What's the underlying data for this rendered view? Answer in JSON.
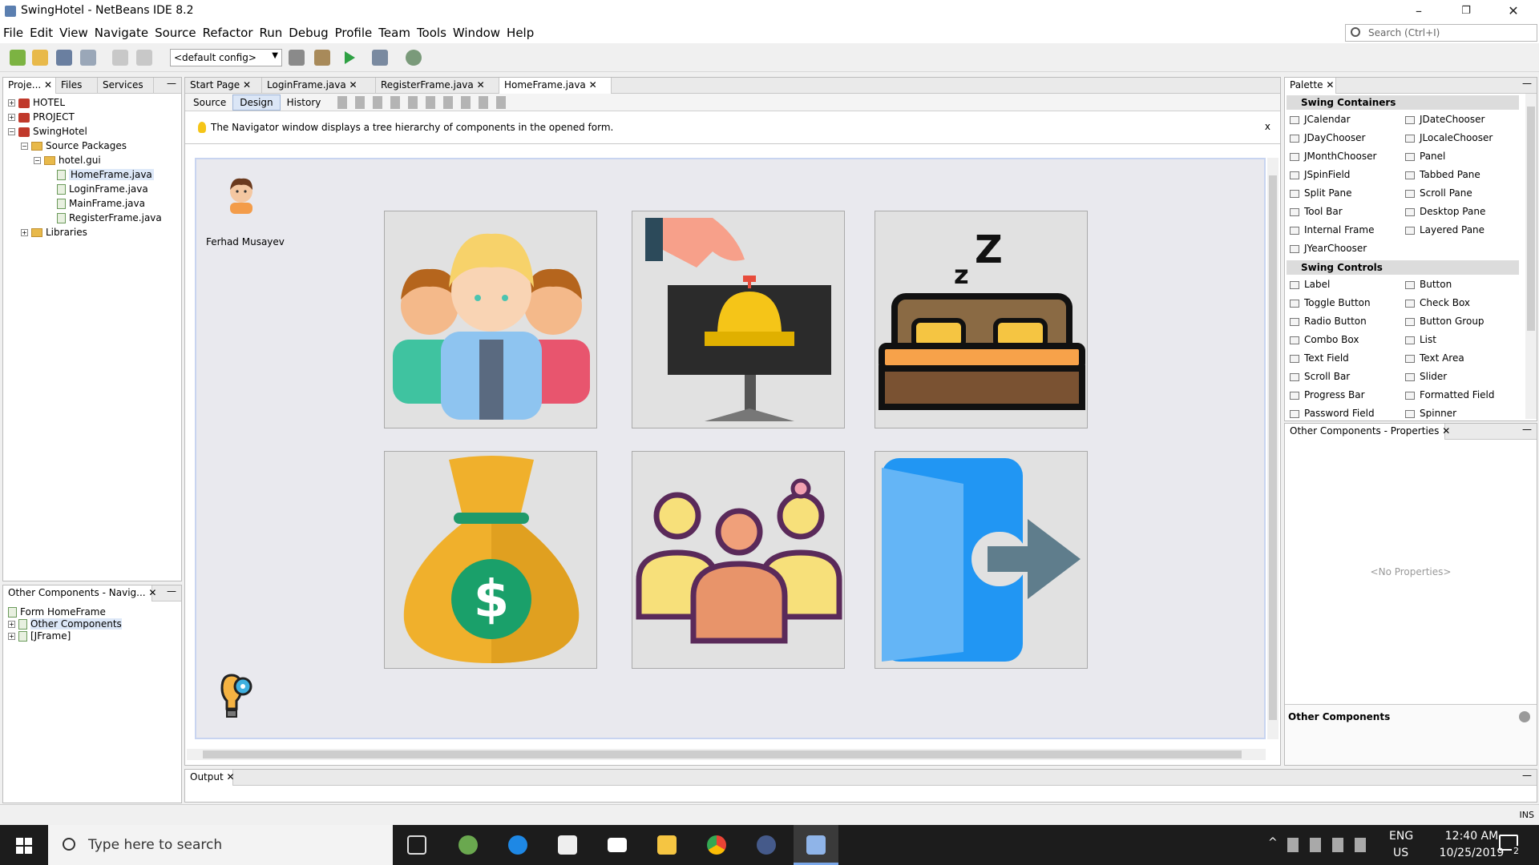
{
  "window": {
    "title": "SwingHotel - NetBeans IDE 8.2",
    "min": "–",
    "restore": "❐",
    "close": "✕"
  },
  "menu": [
    "File",
    "Edit",
    "View",
    "Navigate",
    "Source",
    "Refactor",
    "Run",
    "Debug",
    "Profile",
    "Team",
    "Tools",
    "Window",
    "Help"
  ],
  "search": {
    "placeholder": "Search (Ctrl+I)"
  },
  "toolbar": {
    "config": "<default config>"
  },
  "projects_panel": {
    "tabs": [
      "Proje...",
      "Files",
      "Services"
    ],
    "tree": [
      {
        "label": "HOTEL",
        "level": 0,
        "kind": "project",
        "exp": "+"
      },
      {
        "label": "PROJECT",
        "level": 0,
        "kind": "project",
        "exp": "+"
      },
      {
        "label": "SwingHotel",
        "level": 0,
        "kind": "project",
        "exp": "−"
      },
      {
        "label": "Source Packages",
        "level": 1,
        "kind": "folder",
        "exp": "−"
      },
      {
        "label": "hotel.gui",
        "level": 2,
        "kind": "folder",
        "exp": "−"
      },
      {
        "label": "HomeFrame.java",
        "level": 3,
        "kind": "file",
        "exp": ""
      },
      {
        "label": "LoginFrame.java",
        "level": 3,
        "kind": "file",
        "exp": ""
      },
      {
        "label": "MainFrame.java",
        "level": 3,
        "kind": "file",
        "exp": ""
      },
      {
        "label": "RegisterFrame.java",
        "level": 3,
        "kind": "file",
        "exp": ""
      },
      {
        "label": "Libraries",
        "level": 1,
        "kind": "folder",
        "exp": "+"
      }
    ]
  },
  "navigator_panel": {
    "title": "Other Components - Navig...",
    "tree": [
      {
        "label": "Form HomeFrame",
        "level": 0,
        "exp": ""
      },
      {
        "label": "Other Components",
        "level": 0,
        "exp": "+"
      },
      {
        "label": "[JFrame]",
        "level": 0,
        "exp": "+"
      }
    ]
  },
  "editor": {
    "tabs": [
      "Start Page",
      "LoginFrame.java",
      "RegisterFrame.java",
      "HomeFrame.java"
    ],
    "active_tab": "HomeFrame.java",
    "modes": [
      "Source",
      "Design",
      "History"
    ],
    "active_mode": "Design",
    "notice": "The Navigator window displays a tree hierarchy of components in the opened form.",
    "user_name": "Ferhad Musayev",
    "cells": [
      "staff-icon",
      "reception-bell-icon",
      "bed-icon",
      "money-bag-icon",
      "customers-icon",
      "logout-door-icon"
    ]
  },
  "palette": {
    "title": "Palette",
    "sections": [
      {
        "name": "Swing Containers",
        "items": [
          "JCalendar",
          "JDateChooser",
          "JDayChooser",
          "JLocaleChooser",
          "JMonthChooser",
          "Panel",
          "JSpinField",
          "Tabbed Pane",
          "Split Pane",
          "Scroll Pane",
          "Tool Bar",
          "Desktop Pane",
          "Internal Frame",
          "Layered Pane",
          "JYearChooser"
        ]
      },
      {
        "name": "Swing Controls",
        "items": [
          "Label",
          "Button",
          "Toggle Button",
          "Check Box",
          "Radio Button",
          "Button Group",
          "Combo Box",
          "List",
          "Text Field",
          "Text Area",
          "Scroll Bar",
          "Slider",
          "Progress Bar",
          "Formatted Field",
          "Password Field",
          "Spinner"
        ]
      }
    ]
  },
  "properties": {
    "title": "Other Components - Properties",
    "empty": "<No Properties>",
    "footer": "Other Components"
  },
  "output": {
    "title": "Output"
  },
  "statusbar": {
    "mode": "INS"
  },
  "taskbar": {
    "search_placeholder": "Type here to search",
    "lang": "ENG",
    "region": "US",
    "time": "12:40 AM",
    "date": "10/25/2019",
    "notif_count": "2",
    "colors": {
      "bg": "#1c1c1c",
      "active": "#3a3a3a"
    }
  }
}
